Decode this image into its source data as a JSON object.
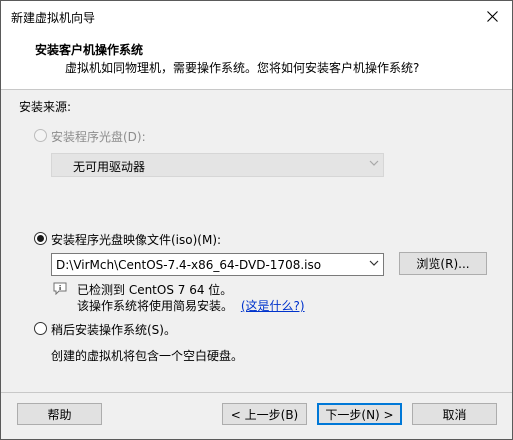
{
  "window": {
    "title": "新建虚拟机向导"
  },
  "header": {
    "title": "安装客户机操作系统",
    "subtitle": "虚拟机如同物理机，需要操作系统。您将如何安装客户机操作系统?"
  },
  "source_label": "安装来源:",
  "option_disc": {
    "label": "安装程序光盘(D):",
    "selected": false,
    "enabled": false,
    "drive_value": "无可用驱动器"
  },
  "option_iso": {
    "label": "安装程序光盘映像文件(iso)(M):",
    "selected": true,
    "path_value": "D:\\VirMch\\CentOS-7.4-x86_64-DVD-1708.iso",
    "browse_label": "浏览(R)...",
    "detect_line1": "已检测到 CentOS 7 64 位。",
    "detect_line2": "该操作系统将使用简易安装。",
    "whats_this": "(这是什么?)"
  },
  "option_later": {
    "label": "稍后安装操作系统(S)。",
    "selected": false,
    "description": "创建的虚拟机将包含一个空白硬盘。"
  },
  "footer": {
    "help": "帮助",
    "back": "< 上一步(B)",
    "next": "下一步(N) >",
    "cancel": "取消"
  },
  "icons": {
    "close": "close-icon",
    "info": "info-icon",
    "dropdown": "chevron-down-icon"
  }
}
